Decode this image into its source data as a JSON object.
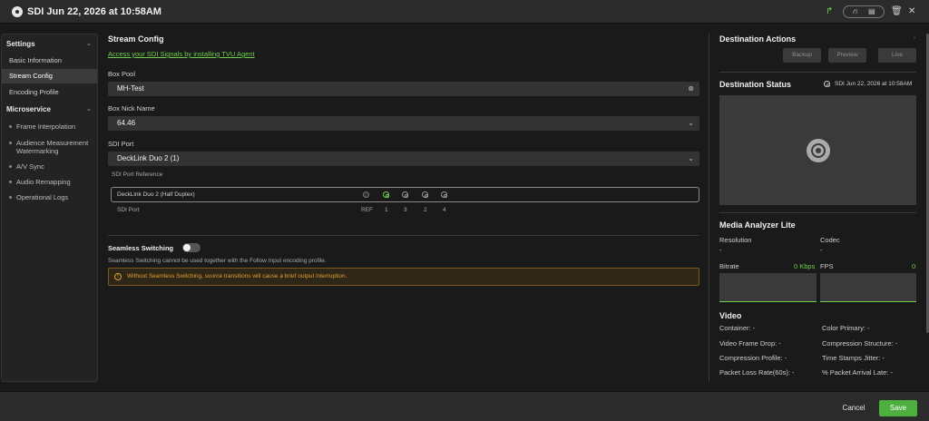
{
  "window": {
    "title": "SDI Jun 22, 2026 at 10:58AM",
    "pill_icon_a": "⛙",
    "pill_icon_b": "▤",
    "share_icon": "↱",
    "trash_icon": "🗑",
    "close_icon": "✕"
  },
  "sidebar": {
    "settings_label": "Settings",
    "settings_items": [
      "Basic Information",
      "Stream Config",
      "Encoding Profile"
    ],
    "active_item": "Stream Config",
    "microservice_label": "Microservice",
    "microservice_items": [
      "Frame Interpolation",
      "Audience Measurement Watermarking",
      "A/V Sync",
      "Audio Remapping",
      "Operational Logs"
    ]
  },
  "stream_config": {
    "title": "Stream Config",
    "agent_link": "Access your SDI Signals by installing TVU Agent",
    "box_pool_label": "Box Pool",
    "box_pool_value": "MH-Test",
    "box_nick_label": "Box Nick Name",
    "box_nick_value": "64.46",
    "sdi_port_label": "SDI Port",
    "sdi_port_value": "DeckLink Duo 2 (1)",
    "ref_label": "SDI Port Reference",
    "ref_device": "DeckLink Duo 2 (Half Duplex)",
    "ref_row_label": "SDI Port",
    "ports": [
      "REF",
      "1",
      "3",
      "2",
      "4"
    ],
    "seamless_label": "Seamless Switching",
    "seamless_enabled": false,
    "seamless_note": "Seamless Switching cannot be used together with the Follow Input encoding profile.",
    "warning": "Without Seamless Switching, source transitions will cause a brief output interruption.",
    "warning_icon": "!"
  },
  "destination": {
    "actions_title": "Destination Actions",
    "actions_dash": "-",
    "buttons": [
      "Backup",
      "Preview",
      "Live"
    ],
    "status_title": "Destination Status",
    "status_time": "SDI Jun 22, 2026 at 10:58AM",
    "analyzer_title": "Media Analyzer Lite",
    "resolution_label": "Resolution",
    "resolution_value": "-",
    "codec_label": "Codec",
    "codec_value": "-",
    "bitrate_label": "Bitrate",
    "bitrate_value": "0 Kbps",
    "fps_label": "FPS",
    "fps_value": "0",
    "video_title": "Video",
    "video_stats": [
      [
        "Container: -",
        "Color Primary: -"
      ],
      [
        "Video Frame Drop: -",
        "Compression Structure: -"
      ],
      [
        "Compression Profile: -",
        "Time Stamps Jitter: -"
      ],
      [
        "Packet Loss Rate(60s): -",
        "% Packet Arrival Late: -"
      ]
    ]
  },
  "footer": {
    "cancel": "Cancel",
    "save": "Save"
  },
  "colors": {
    "accent": "#6fcf4d",
    "save": "#4caf3e",
    "warning": "#e0a030"
  }
}
